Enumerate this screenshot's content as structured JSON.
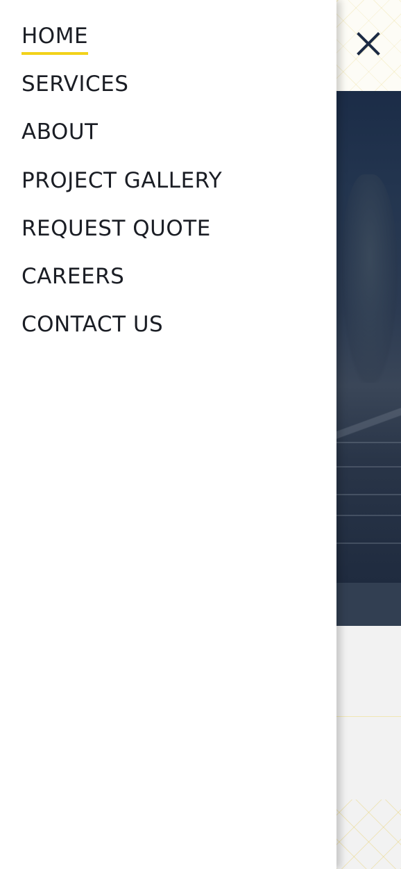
{
  "nav": {
    "items": [
      {
        "label": "HOME",
        "active": true
      },
      {
        "label": "SERVICES",
        "active": false
      },
      {
        "label": "ABOUT",
        "active": false
      },
      {
        "label": "PROJECT GALLERY",
        "active": false
      },
      {
        "label": "REQUEST QUOTE",
        "active": false
      },
      {
        "label": "CAREERS",
        "active": false
      },
      {
        "label": "CONTACT US",
        "active": false
      }
    ]
  },
  "close": {
    "icon": "close-icon"
  },
  "colors": {
    "accent": "#f2d21a",
    "text": "#1a1d24",
    "close_icon": "#1b2a44",
    "hero": "#23354f"
  }
}
